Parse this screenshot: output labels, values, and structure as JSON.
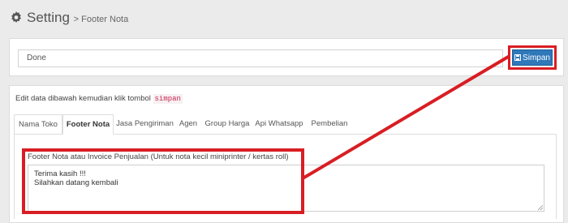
{
  "header": {
    "title": "Setting",
    "subtitle": "> Footer Nota"
  },
  "top": {
    "status_value": "Done",
    "save_label": "Simpan"
  },
  "instruction": {
    "text": "Edit data dibawah kemudian klik tombol",
    "code": "simpan"
  },
  "tabs": [
    {
      "label": "Nama Toko"
    },
    {
      "label": "Footer Nota"
    },
    {
      "label": "Jasa Pengiriman"
    },
    {
      "label": "Agen"
    },
    {
      "label": "Group Harga"
    },
    {
      "label": "Api Whatsapp"
    },
    {
      "label": "Pembelian"
    }
  ],
  "footer": {
    "label": "Footer Nota atau Invoice Penjualan (Untuk nota kecil miniprinter / kertas roll)",
    "text": "Terima kasih !!!\nSilahkan datang kembali"
  },
  "colors": {
    "highlight": "#d81e24",
    "button": "#2f78b9"
  }
}
